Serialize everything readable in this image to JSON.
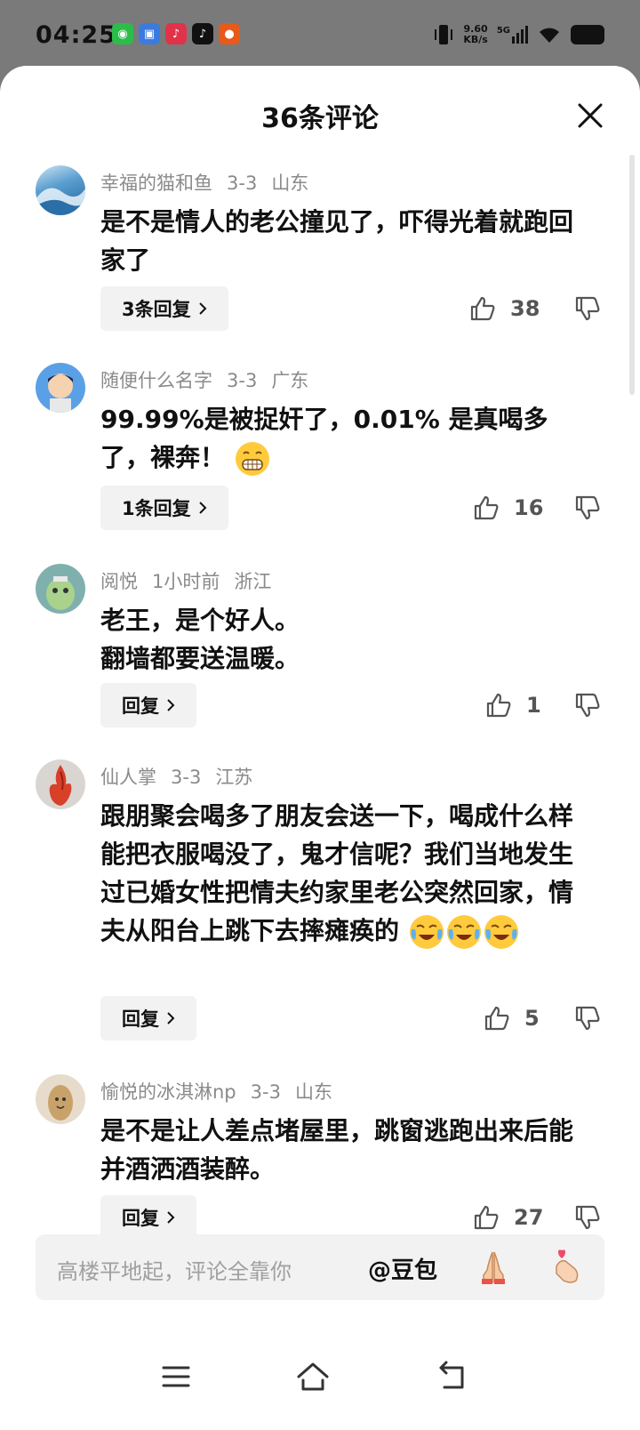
{
  "status_bar": {
    "time": "04:25",
    "net_speed_value": "9.60",
    "net_speed_unit": "KB/s",
    "network": "5G",
    "apps": [
      "wechat-icon",
      "app-icon",
      "tiktok-lite-icon",
      "tiktok-icon",
      "game-icon"
    ]
  },
  "header": {
    "title": "36条评论"
  },
  "comments": [
    {
      "user": "幸福的猫和鱼",
      "date": "3-3",
      "region": "山东",
      "text": "是不是情人的老公撞见了，吓得光着就跑回家了",
      "reply_label": "3条回复",
      "likes": "38"
    },
    {
      "user": "随便什么名字",
      "date": "3-3",
      "region": "广东",
      "text": "99.99%是被捉奸了，0.01% 是真喝多了，裸奔！",
      "reply_label": "1条回复",
      "likes": "16"
    },
    {
      "user": "阅悦",
      "date": "1小时前",
      "region": "浙江",
      "text_line1": "老王，是个好人。",
      "text_line2": "翻墙都要送温暖。",
      "reply_label": "回复",
      "likes": "1"
    },
    {
      "user": "仙人掌",
      "date": "3-3",
      "region": "江苏",
      "text": "跟朋聚会喝多了朋友会送一下，喝成什么样能把衣服喝没了，鬼才信呢？我们当地发生过已婚女性把情夫约家里老公突然回家，情夫从阳台上跳下去摔瘫痪的",
      "reply_label": "回复",
      "likes": "5"
    },
    {
      "user": "愉悦的冰淇淋np",
      "date": "3-3",
      "region": "山东",
      "text": "是不是让人差点堵屋里，跳窗逃跑出来后能并酒洒酒装醉。",
      "reply_label": "回复",
      "likes": "27"
    }
  ],
  "input": {
    "placeholder": "高楼平地起，评论全靠你",
    "mention": "@豆包"
  },
  "colors": {
    "like_gray": "#555555",
    "meta_gray": "#8a8a8a",
    "button_bg": "#f2f2f2"
  }
}
